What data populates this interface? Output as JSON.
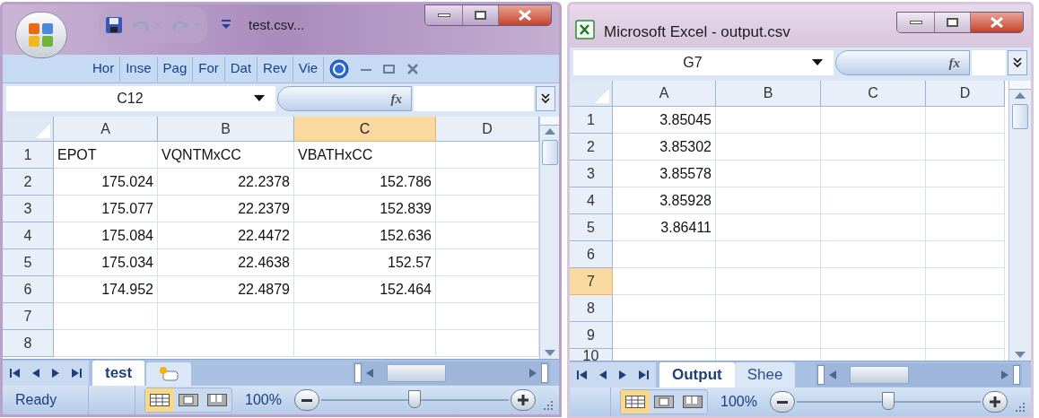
{
  "windows": [
    {
      "kind": "office_button",
      "title": "test.csv...",
      "ribbon_tabs": [
        "Hor",
        "Inse",
        "Pag",
        "For",
        "Dat",
        "Rev",
        "Vie"
      ],
      "name_box": "C12",
      "fx_label": "fx",
      "columns": [
        {
          "label": "A",
          "selected": false
        },
        {
          "label": "B",
          "selected": false
        },
        {
          "label": "C",
          "selected": true
        },
        {
          "label": "D",
          "selected": false
        }
      ],
      "rows": [
        {
          "label": "1",
          "selected": false,
          "cells": [
            {
              "text": "EPOT",
              "kind": "text"
            },
            {
              "text": "VQNTMxCC",
              "kind": "text"
            },
            {
              "text": "VBATHxCC",
              "kind": "text"
            }
          ]
        },
        {
          "label": "2",
          "selected": false,
          "cells": [
            {
              "text": "175.024",
              "kind": "number"
            },
            {
              "text": "22.2378",
              "kind": "number"
            },
            {
              "text": "152.786",
              "kind": "number"
            }
          ]
        },
        {
          "label": "3",
          "selected": false,
          "cells": [
            {
              "text": "175.077",
              "kind": "number"
            },
            {
              "text": "22.2379",
              "kind": "number"
            },
            {
              "text": "152.839",
              "kind": "number"
            }
          ]
        },
        {
          "label": "4",
          "selected": false,
          "cells": [
            {
              "text": "175.084",
              "kind": "number"
            },
            {
              "text": "22.4472",
              "kind": "number"
            },
            {
              "text": "152.636",
              "kind": "number"
            }
          ]
        },
        {
          "label": "5",
          "selected": false,
          "cells": [
            {
              "text": "175.034",
              "kind": "number"
            },
            {
              "text": "22.4638",
              "kind": "number"
            },
            {
              "text": "152.57",
              "kind": "number"
            }
          ]
        },
        {
          "label": "6",
          "selected": false,
          "cells": [
            {
              "text": "174.952",
              "kind": "number"
            },
            {
              "text": "22.4879",
              "kind": "number"
            },
            {
              "text": "152.464",
              "kind": "number"
            }
          ]
        },
        {
          "label": "7",
          "selected": false,
          "cells": []
        },
        {
          "label": "8",
          "selected": false,
          "cells": []
        }
      ],
      "sheet_tabs": [
        {
          "label": "test",
          "selected": true
        }
      ],
      "status": "Ready",
      "zoom": "100%",
      "zoom_slider": {
        "level": 0.5
      }
    },
    {
      "kind": "excel_icon",
      "title": "Microsoft Excel - output.csv",
      "name_box": "G7",
      "fx_label": "fx",
      "columns": [
        {
          "label": "A",
          "selected": false
        },
        {
          "label": "B",
          "selected": false
        },
        {
          "label": "C",
          "selected": false
        },
        {
          "label": "D",
          "selected": false
        }
      ],
      "rows": [
        {
          "label": "1",
          "selected": false,
          "cells": [
            {
              "text": "3.85045",
              "kind": "number"
            }
          ]
        },
        {
          "label": "2",
          "selected": false,
          "cells": [
            {
              "text": "3.85302",
              "kind": "number"
            }
          ]
        },
        {
          "label": "3",
          "selected": false,
          "cells": [
            {
              "text": "3.85578",
              "kind": "number"
            }
          ]
        },
        {
          "label": "4",
          "selected": false,
          "cells": [
            {
              "text": "3.85928",
              "kind": "number"
            }
          ]
        },
        {
          "label": "5",
          "selected": false,
          "cells": [
            {
              "text": "3.86411",
              "kind": "number"
            }
          ]
        },
        {
          "label": "6",
          "selected": false,
          "cells": []
        },
        {
          "label": "7",
          "selected": true,
          "cells": []
        },
        {
          "label": "8",
          "selected": false,
          "cells": []
        },
        {
          "label": "9",
          "selected": false,
          "cells": []
        },
        {
          "label": "10",
          "selected": false,
          "cells": []
        }
      ],
      "sheet_tabs": [
        {
          "label": "Output",
          "selected": true
        },
        {
          "label": "Shee",
          "selected": false
        }
      ],
      "zoom": "100%",
      "zoom_slider": {
        "level": 0.5
      }
    }
  ]
}
